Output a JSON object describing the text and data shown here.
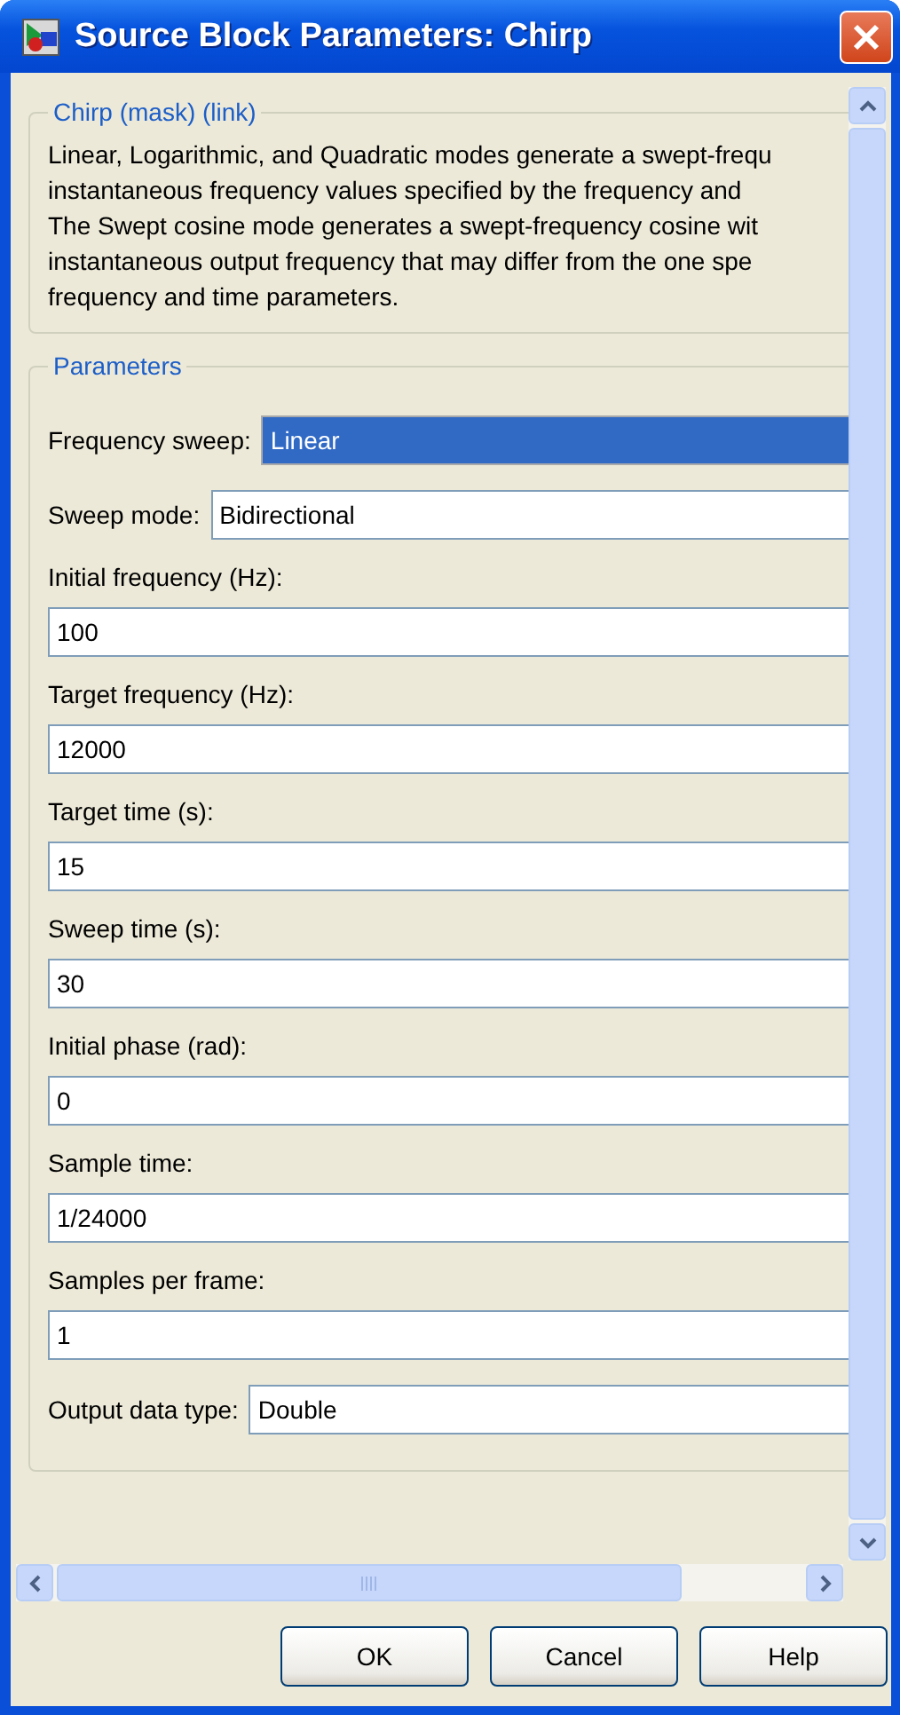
{
  "window": {
    "title": "Source Block Parameters: Chirp"
  },
  "description": {
    "title": "Chirp (mask) (link)",
    "lines": [
      "Linear, Logarithmic, and Quadratic modes generate a swept-frequ",
      "instantaneous frequency values specified by the frequency and",
      "The Swept cosine mode generates a swept-frequency cosine wit",
      "instantaneous output frequency that may differ from the one spe",
      "frequency and time parameters."
    ]
  },
  "parameters": {
    "title": "Parameters",
    "items": [
      {
        "kind": "inline",
        "label": "Frequency sweep:",
        "value": "Linear",
        "selected": true
      },
      {
        "kind": "inline",
        "label": "Sweep mode:",
        "value": "Bidirectional",
        "selected": false
      },
      {
        "kind": "stacked",
        "label": "Initial frequency (Hz):",
        "value": "100",
        "selected": false
      },
      {
        "kind": "stacked",
        "label": "Target frequency (Hz):",
        "value": "12000",
        "selected": false
      },
      {
        "kind": "stacked",
        "label": "Target time (s):",
        "value": "15",
        "selected": false
      },
      {
        "kind": "stacked",
        "label": "Sweep time (s):",
        "value": "30",
        "selected": false
      },
      {
        "kind": "stacked",
        "label": "Initial phase (rad):",
        "value": "0",
        "selected": false
      },
      {
        "kind": "stacked",
        "label": "Sample time:",
        "value": "1/24000",
        "selected": false
      },
      {
        "kind": "stacked",
        "label": "Samples per frame:",
        "value": "1",
        "selected": false
      },
      {
        "kind": "inline",
        "label": "Output data type:",
        "value": "Double",
        "selected": false
      }
    ]
  },
  "buttons": [
    "OK",
    "Cancel",
    "Help"
  ]
}
